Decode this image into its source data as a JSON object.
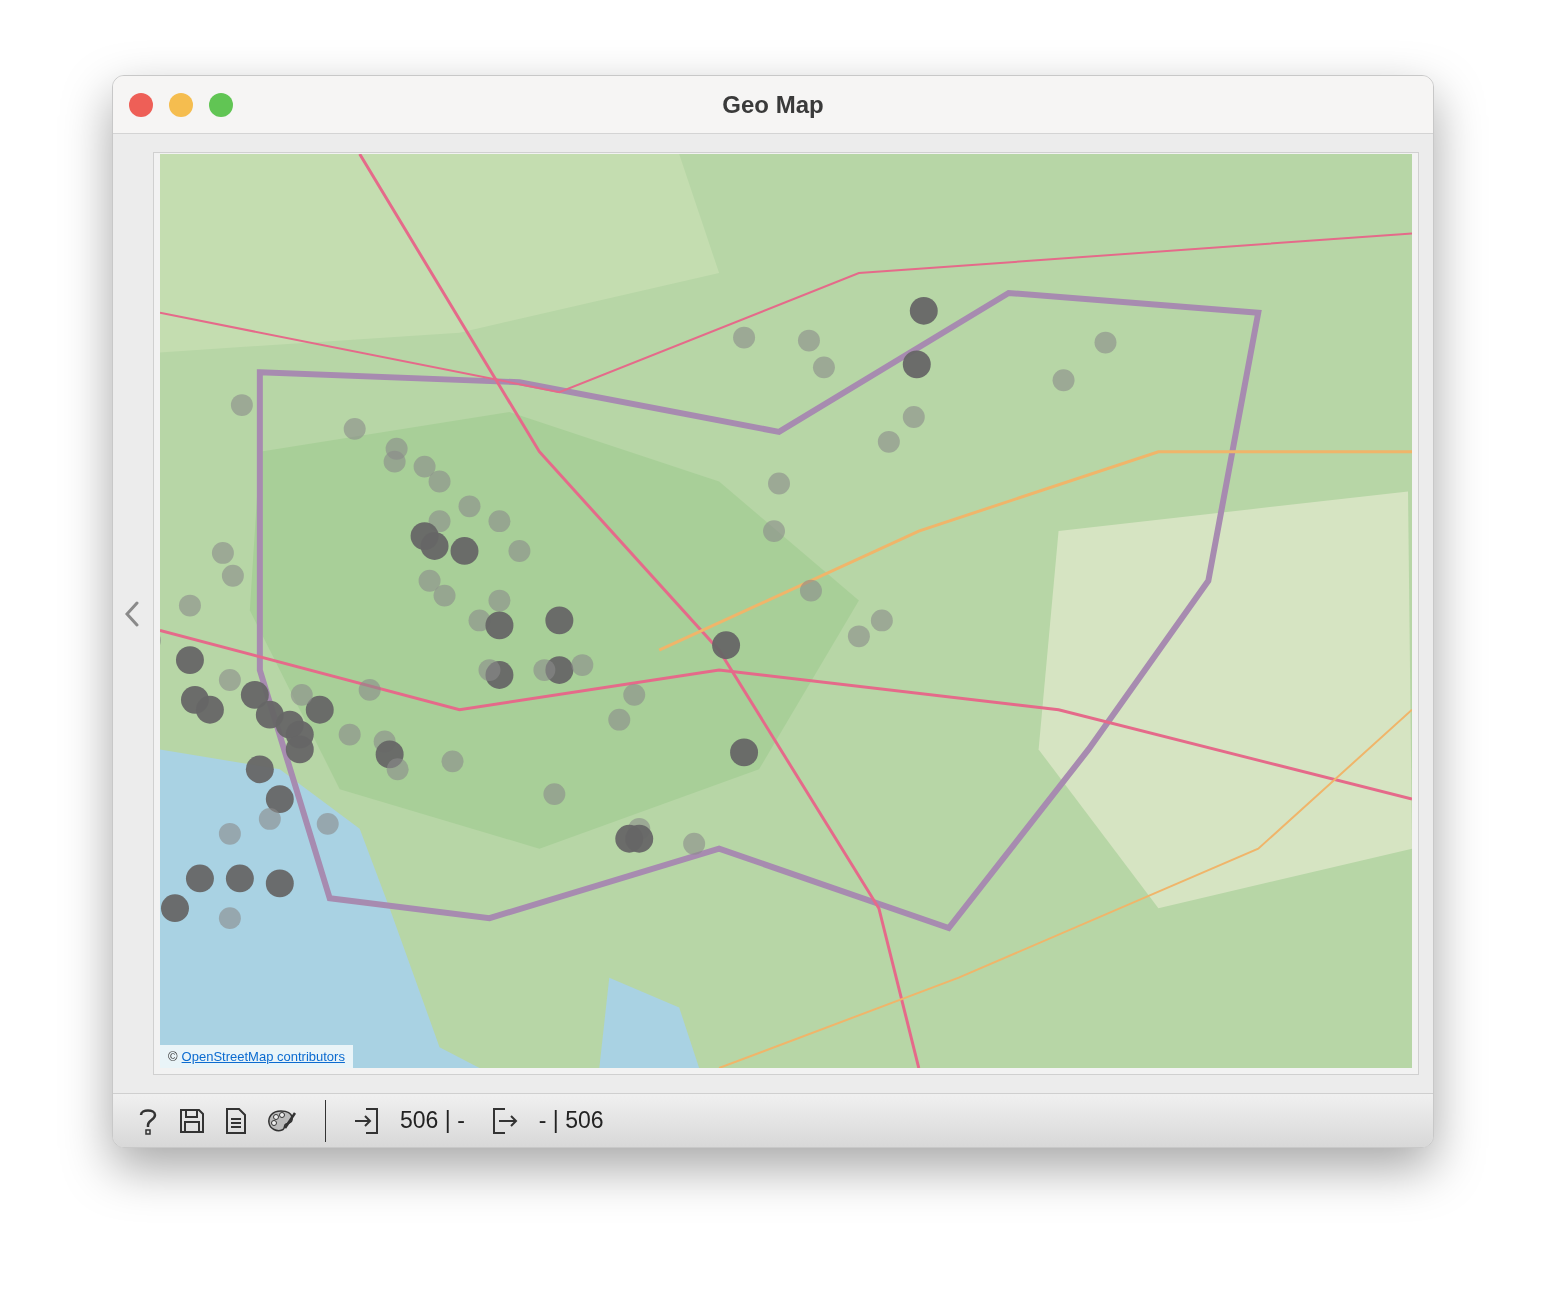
{
  "window": {
    "title": "Geo Map"
  },
  "map": {
    "kind": "picture",
    "attribution": {
      "symbol": "©",
      "link": "OpenStreetMap contributors"
    }
  },
  "status_bar": {
    "input_count": "506 | -",
    "output_count": "- | 506"
  }
}
